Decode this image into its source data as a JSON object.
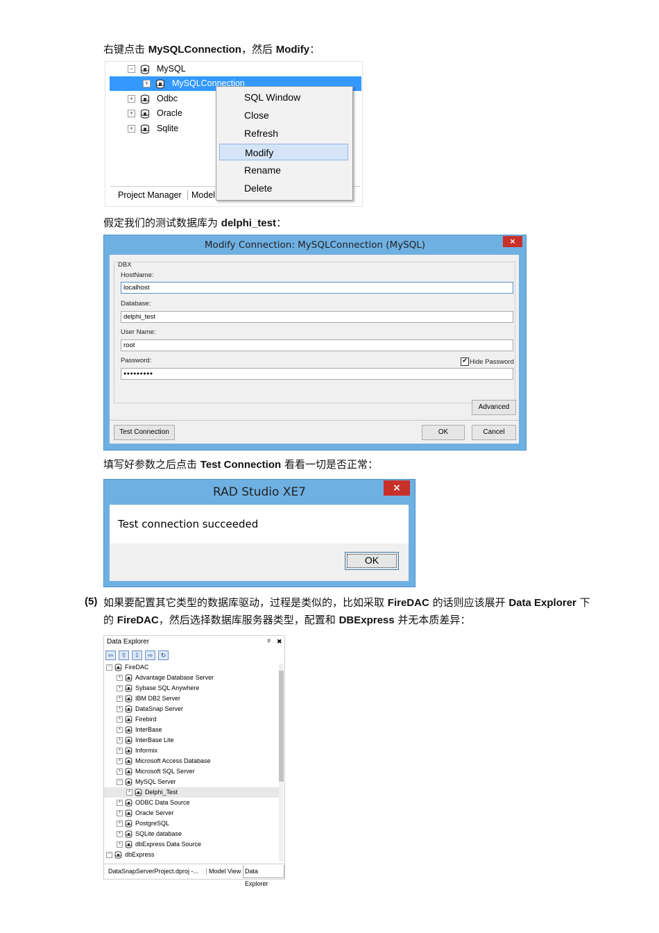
{
  "paragraphs": {
    "p1_prefix": "右键点击 ",
    "p1_bold1": "MySQLConnection",
    "p1_mid": "，然后 ",
    "p1_bold2": "Modify",
    "p1_suffix": "：",
    "p2_prefix": "假定我们的测试数据库为 ",
    "p2_bold": "delphi_test",
    "p2_suffix": "：",
    "p3_prefix": "填写好参数之后点击 ",
    "p3_bold": "Test Connection",
    "p3_suffix": " 看看一切是否正常：",
    "p4_number": "(5)",
    "p4_line1_a": "如果要配置其它类型的数据库驱动，过程是类似的，比如采取 ",
    "p4_line1_b": "FireDAC",
    "p4_line1_c": " 的话则应该展开 ",
    "p4_line1_d": "Data Explorer",
    "p4_line1_e": " 下",
    "p4_line2_a": "的 ",
    "p4_line2_b": "FireDAC",
    "p4_line2_c": "，然后选择数据库服务器类型，配置和 ",
    "p4_line2_d": "DBExpress",
    "p4_line2_e": " 并无本质差异："
  },
  "tree1": {
    "items": [
      "MySQL",
      "MySQLConnection",
      "Odbc",
      "Oracle",
      "Sqlite"
    ],
    "tabs": [
      "Project Manager",
      "Model"
    ]
  },
  "context_menu": {
    "items": [
      "SQL Window",
      "Close",
      "Refresh",
      "Modify",
      "Rename",
      "Delete"
    ],
    "highlighted": "Modify"
  },
  "modify_dialog": {
    "title": "Modify Connection: MySQLConnection (MySQL)",
    "close": "×",
    "group": "DBX",
    "hostname_label": "HostName:",
    "hostname_value": "localhost",
    "database_label": "Database:",
    "database_value": "delphi_test",
    "username_label": "User Name:",
    "username_value": "root",
    "password_label": "Password:",
    "password_value": "●●●●●●●●●",
    "hide_password_label": "Hide Password",
    "hide_password_checked": true,
    "advanced": "Advanced",
    "test_connection": "Test Connection",
    "ok": "OK",
    "cancel": "Cancel"
  },
  "test_dialog": {
    "title": "RAD Studio XE7",
    "close": "×",
    "message": "Test connection succeeded",
    "ok": "OK"
  },
  "data_explorer": {
    "title": "Data Explorer",
    "pin": "ᵖ",
    "close": "✖",
    "root": "FireDAC",
    "items": [
      "Advantage Database Server",
      "Sybase SQL Anywhere",
      "IBM DB2 Server",
      "DataSnap Server",
      "Firebird",
      "InterBase",
      "InterBase Lite",
      "Informix",
      "Microsoft Access Database",
      "Microsoft SQL Server",
      "MySQL Server"
    ],
    "child": "Delphi_Test",
    "items_after": [
      "ODBC Data Source",
      "Oracle Server",
      "PostgreSQL",
      "SQLite database",
      "dbExpress Data Source"
    ],
    "root2": "dbExpress",
    "tabs": [
      "DataSnapServerProject.dproj -...",
      "Model View",
      "Data Explorer"
    ]
  },
  "colors": {
    "selection": "#3399ff",
    "dialog_frame": "#6fb0e2",
    "close_button": "#c8312a"
  }
}
